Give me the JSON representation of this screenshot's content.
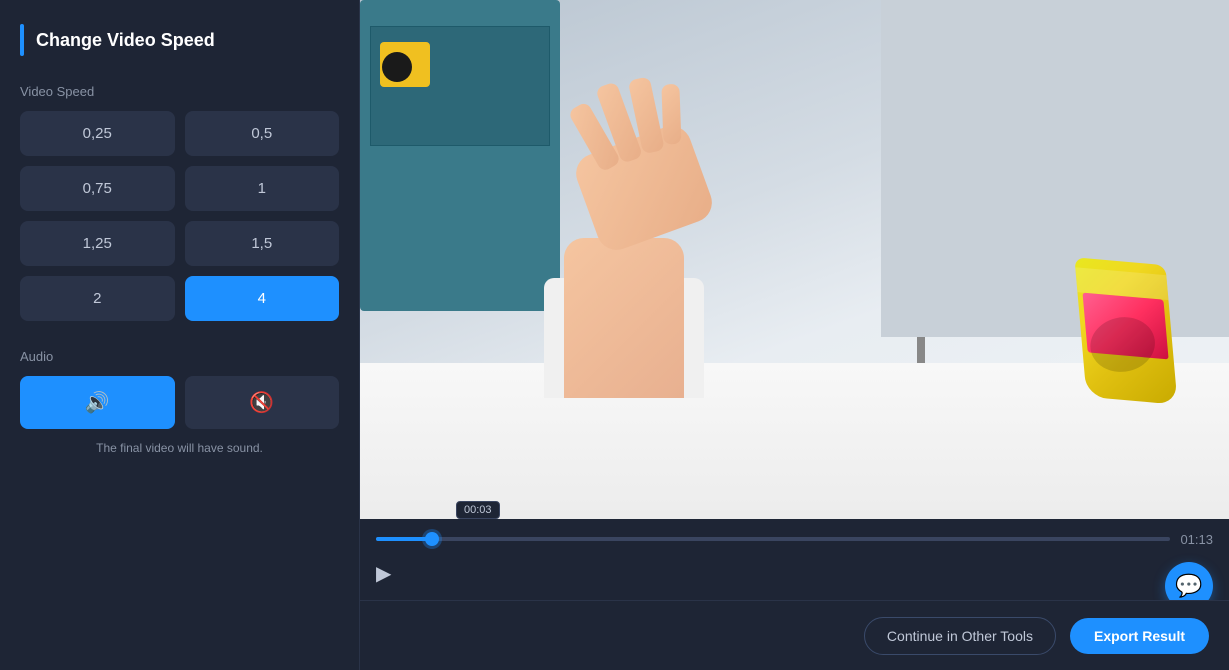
{
  "sidebar": {
    "title": "Change Video Speed",
    "accent_color": "#1e90ff",
    "video_speed_label": "Video Speed",
    "speed_options": [
      {
        "value": "0,25",
        "active": false
      },
      {
        "value": "0,5",
        "active": false
      },
      {
        "value": "0,75",
        "active": false
      },
      {
        "value": "1",
        "active": false
      },
      {
        "value": "1,25",
        "active": false
      },
      {
        "value": "1,5",
        "active": false
      },
      {
        "value": "2",
        "active": false
      },
      {
        "value": "4",
        "active": true
      }
    ],
    "audio_label": "Audio",
    "audio_on_icon": "🔊",
    "audio_off_icon": "🔇",
    "audio_hint": "The final video will have sound."
  },
  "video": {
    "current_time": "00:03",
    "total_time": "01:13",
    "progress_percent": 7,
    "play_icon": "▶"
  },
  "footer": {
    "continue_label": "Continue in Other Tools",
    "export_label": "Export Result"
  },
  "chat": {
    "icon": "💬"
  }
}
